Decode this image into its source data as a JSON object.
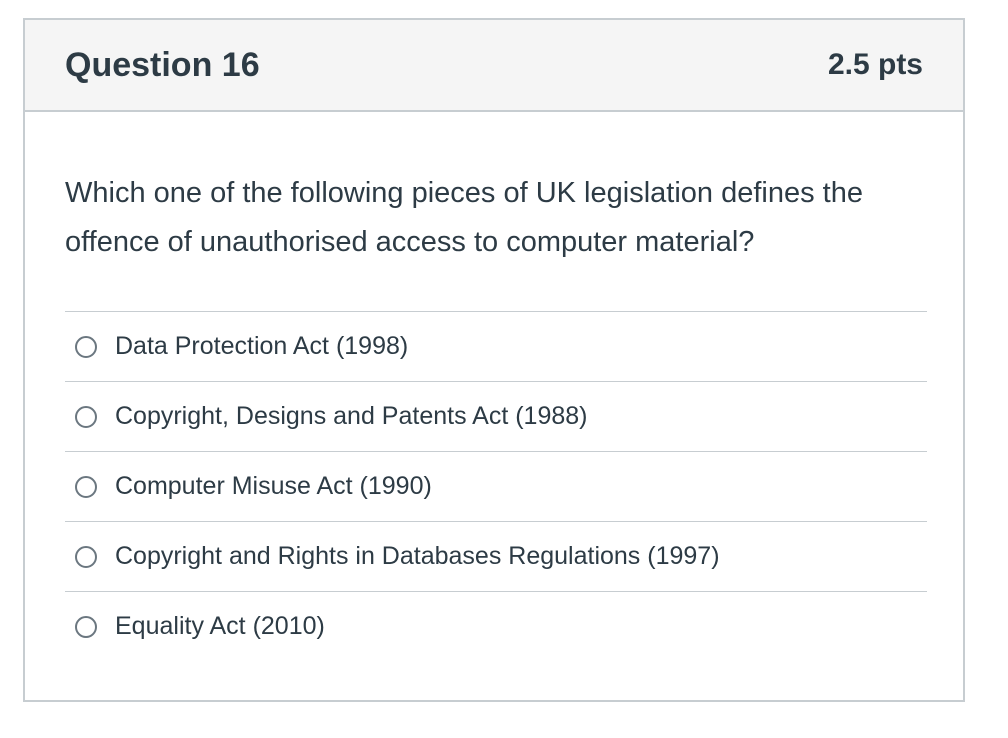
{
  "question": {
    "title": "Question 16",
    "points": "2.5 pts",
    "text": "Which one of the following pieces of UK legislation defines the offence of unauthorised access to computer material?"
  },
  "answers": [
    {
      "label": "Data Protection Act (1998)"
    },
    {
      "label": "Copyright, Designs and Patents Act (1988)"
    },
    {
      "label": "Computer Misuse Act (1990)"
    },
    {
      "label": "Copyright and Rights in Databases Regulations (1997)"
    },
    {
      "label": "Equality Act (2010)"
    }
  ]
}
